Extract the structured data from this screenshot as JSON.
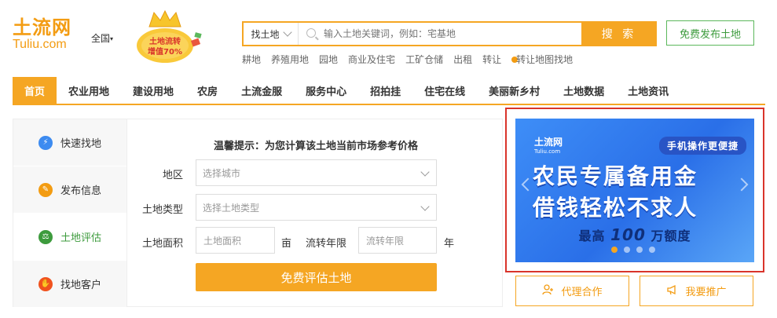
{
  "header": {
    "logo_cn": "土流网",
    "logo_en": "Tuliu.com",
    "city": "全国",
    "badge_text": [
      "土地流转",
      "增值70%"
    ],
    "publish_button": "免费发布土地"
  },
  "search": {
    "type_label": "找土地",
    "placeholder": "输入土地关键词，例如：宅基地",
    "button": "搜 索",
    "hot_links": [
      "耕地",
      "养殖用地",
      "园地",
      "商业及住宅",
      "工矿仓储",
      "出租",
      "转让",
      "转让地图找地"
    ]
  },
  "nav": {
    "items": [
      "首页",
      "农业用地",
      "建设用地",
      "农房",
      "土流金服",
      "服务中心",
      "招拍挂",
      "住宅在线",
      "美丽新乡村",
      "土地数据",
      "土地资讯"
    ]
  },
  "side_tabs": [
    {
      "label": "快速找地",
      "icon": "lightning-icon",
      "color": "#3d8bf0"
    },
    {
      "label": "发布信息",
      "icon": "pencil-icon",
      "color": "#f39c12"
    },
    {
      "label": "土地评估",
      "icon": "scale-icon",
      "color": "#3d9b3d"
    },
    {
      "label": "找地客户",
      "icon": "handshake-icon",
      "color": "#f0521e"
    }
  ],
  "form": {
    "title": "温馨提示：为您计算该土地当前市场参考价格",
    "region_label": "地区",
    "region_placeholder": "选择城市",
    "type_label": "土地类型",
    "type_placeholder": "选择土地类型",
    "area_label": "土地面积",
    "area_placeholder": "土地面积",
    "area_unit": "亩",
    "term_label": "流转年限",
    "term_placeholder": "流转年限",
    "term_unit": "年",
    "submit": "免费评估土地"
  },
  "banner": {
    "brand": "土流网",
    "brand_en": "Tuliu.com",
    "tag": "手机操作更便捷",
    "line1": "农民专属备用金",
    "line2": "借钱轻松不求人",
    "sub_prefix": "最高",
    "sub_amount": "100",
    "sub_suffix": "万额度",
    "active_slide": 1,
    "slide_count": 4
  },
  "actions": {
    "agent": "代理合作",
    "promote": "我要推广"
  },
  "colors": {
    "accent": "#f5a623",
    "green": "#3d9b3d",
    "highlight_border": "#d9342b"
  }
}
